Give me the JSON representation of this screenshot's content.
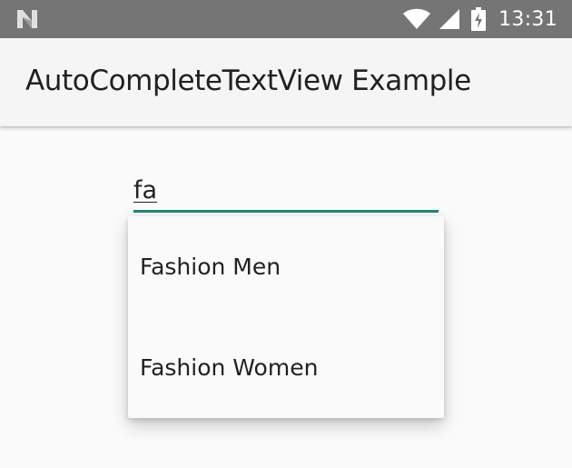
{
  "status_bar": {
    "time": "13:31",
    "icons": [
      "notification-n-icon",
      "wifi-icon",
      "cell-signal-icon",
      "battery-charging-icon"
    ],
    "background": "#757575"
  },
  "app_bar": {
    "title": "AutoCompleteTextView Example",
    "background": "#f5f5f5"
  },
  "autocomplete": {
    "value": "fa",
    "accent_color": "#178a7b",
    "suggestions": [
      {
        "label": "Fashion Men"
      },
      {
        "label": "Fashion Women"
      }
    ]
  }
}
